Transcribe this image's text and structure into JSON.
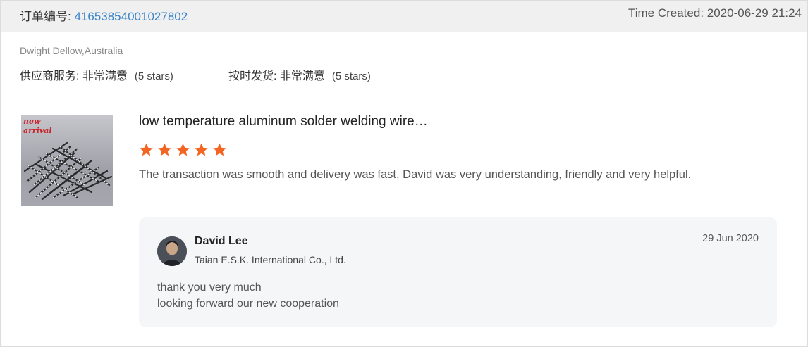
{
  "order": {
    "label": "订单编号: ",
    "number": "41653854001027802",
    "time_created": "Time Created: 2020-06-29 21:24"
  },
  "buyer": {
    "name_location": "Dwight Dellow,Australia"
  },
  "ratings": [
    {
      "label": "供应商服务: ",
      "value": "非常满意",
      "stars": "(5 stars)",
      "level": 5
    },
    {
      "label": "按时发货: ",
      "value": "非常满意",
      "stars": "(5 stars)",
      "level": 5
    }
  ],
  "product": {
    "image_text": [
      "new",
      "arrival"
    ],
    "title": "low temperature aluminum solder welding wire…",
    "star_rating": 5,
    "star_color": "#f26522",
    "review": "The transaction was smooth and delivery was fast, David was very understanding, friendly and very helpful."
  },
  "reply": {
    "name": "David Lee",
    "company": "Taian E.S.K. International Co., Ltd.",
    "date": "29 Jun 2020",
    "lines": [
      "thank you very much",
      "looking forward our new cooperation"
    ]
  },
  "colors": {
    "link_blue": "#3a84c9",
    "header_bg": "#f0f0f0",
    "reply_bg": "#f5f6f8"
  }
}
